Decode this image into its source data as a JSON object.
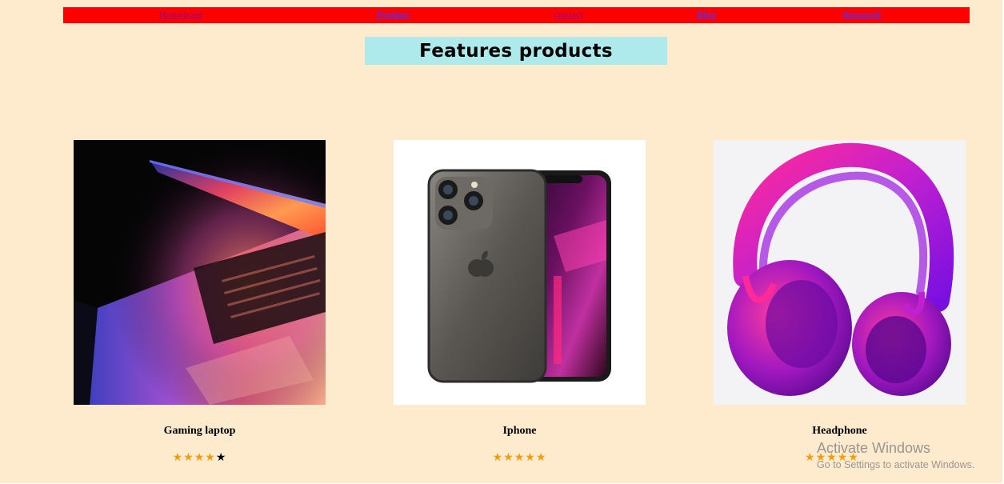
{
  "nav": {
    "items": [
      {
        "label": "Homepage",
        "state": "visited"
      },
      {
        "label": "Product",
        "state": "unvisited"
      },
      {
        "label": "contact",
        "state": "visited"
      },
      {
        "label": "Blog",
        "state": "unvisited"
      },
      {
        "label": "Research",
        "state": "unvisited"
      }
    ]
  },
  "page": {
    "title": "Features products"
  },
  "products": [
    {
      "name": "Gaming laptop",
      "rating": 4,
      "rating_max": 5,
      "image": "laptop-photo"
    },
    {
      "name": "Iphone",
      "rating": 5,
      "rating_max": 5,
      "image": "iphone-photo"
    },
    {
      "name": "Headphone",
      "rating": 5,
      "rating_max": 5,
      "image": "headphone-photo"
    }
  ],
  "watermark": {
    "title": "Activate Windows",
    "subtitle": "Go to Settings to activate Windows."
  },
  "colors": {
    "background": "#feebce",
    "navbar": "#ff0000",
    "title_box": "#aeeaec",
    "star_filled": "#f39c12",
    "star_empty": "#000000",
    "visited_link": "#b00060",
    "unvisited_link": "#6b2bd1"
  }
}
